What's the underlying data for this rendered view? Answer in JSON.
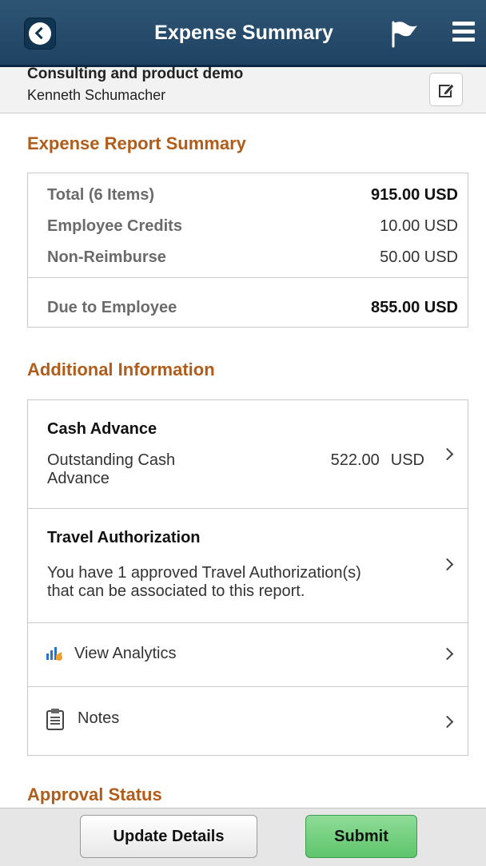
{
  "header": {
    "title": "Expense Summary"
  },
  "report": {
    "description": "Consulting and product demo",
    "employee": "Kenneth Schumacher"
  },
  "summary": {
    "title": "Expense Report Summary",
    "rows": [
      {
        "label": "Total (6 Items)",
        "value": "915.00 USD"
      },
      {
        "label": "Employee Credits",
        "value": "10.00 USD"
      },
      {
        "label": "Non-Reimburse",
        "value": "50.00 USD"
      }
    ],
    "due": {
      "label": "Due to Employee",
      "value": "855.00 USD"
    }
  },
  "additional": {
    "title": "Additional Information",
    "cash_advance": {
      "heading": "Cash Advance",
      "label_line1": "Outstanding Cash",
      "label_line2": "Advance",
      "amount": "522.00",
      "currency": "USD"
    },
    "travel_auth": {
      "heading": "Travel Authorization",
      "line1": "You have 1 approved Travel Authorization(s)",
      "line2": "that can be associated to this report."
    },
    "analytics_label": "View Analytics",
    "notes_label": "Notes"
  },
  "approval": {
    "title": "Approval Status"
  },
  "footer": {
    "update_label": "Update Details",
    "submit_label": "Submit"
  },
  "icons": {
    "back": "back-arrow-icon",
    "flag": "flag-icon",
    "menu": "hamburger-menu-icon",
    "edit": "edit-icon",
    "analytics": "analytics-chart-icon",
    "notes": "clipboard-icon",
    "chevron": "chevron-right-icon"
  },
  "colors": {
    "header": "#1e4262",
    "section_title": "#b05d1b",
    "submit": "#5ec56c"
  }
}
